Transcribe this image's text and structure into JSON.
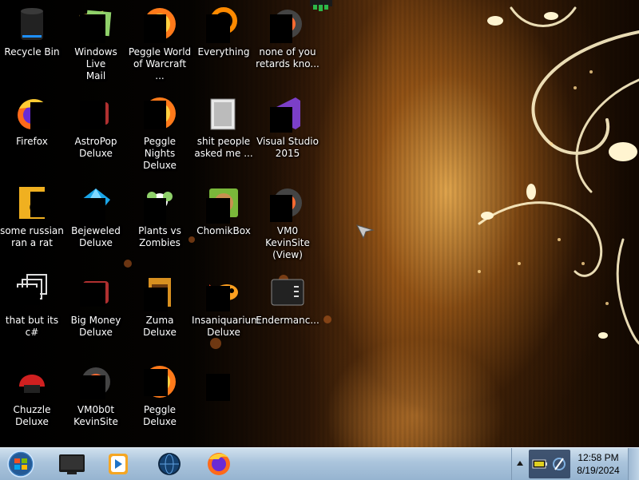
{
  "desktop": {
    "icons": [
      {
        "label": "Recycle Bin",
        "icon": "recycle-bin-icon"
      },
      {
        "label": "Windows Live\nMail",
        "icon": "mail-icon"
      },
      {
        "label": "Peggle World\nof Warcraft ...",
        "icon": "peggle-icon"
      },
      {
        "label": "Everything",
        "icon": "everything-search-icon"
      },
      {
        "label": "none of you\nretards kno...",
        "icon": "app-icon"
      },
      {
        "label": "Firefox",
        "icon": "firefox-icon"
      },
      {
        "label": "AstroPop\nDeluxe",
        "icon": "game-icon"
      },
      {
        "label": "Peggle Nights\nDeluxe",
        "icon": "peggle-icon"
      },
      {
        "label": "shit people\nasked me ...",
        "icon": "folder-icon"
      },
      {
        "label": "Visual Studio\n2015",
        "icon": "visual-studio-icon"
      },
      {
        "label": "some russian\nran a rat",
        "icon": "document-icon"
      },
      {
        "label": "Bejeweled\nDeluxe",
        "icon": "gem-icon"
      },
      {
        "label": "Plants vs\nZombies",
        "icon": "plant-icon"
      },
      {
        "label": "ChomikBox",
        "icon": "hamster-icon"
      },
      {
        "label": "VM0 KevinSite\n(View)",
        "icon": "app-icon"
      },
      {
        "label": "that but its c#",
        "icon": "files-icon"
      },
      {
        "label": "Big Money\nDeluxe",
        "icon": "game-icon"
      },
      {
        "label": "Zuma Deluxe",
        "icon": "zuma-icon"
      },
      {
        "label": "Insaniquarium\nDeluxe",
        "icon": "fish-icon"
      },
      {
        "label": "Endermanc...",
        "icon": "terminal-icon"
      },
      {
        "label": "Chuzzle\nDeluxe",
        "icon": "chuzzle-icon"
      },
      {
        "label": "VM0b0t\nKevinSite",
        "icon": "app-icon"
      },
      {
        "label": "Peggle Deluxe",
        "icon": "peggle-icon"
      }
    ]
  },
  "taskbar": {
    "start": "windows-start-icon",
    "pinned": [
      "monitor-app-icon",
      "media-player-icon",
      "globe-app-icon",
      "firefox-icon"
    ],
    "tray_icons": [
      "show-hidden-icons-chevron",
      "battery-icon",
      "network-icon"
    ],
    "time": "12:58 PM",
    "date": "8/19/2024"
  },
  "colors": {
    "taskbar": "#aac4dc",
    "accent_gold": "#e8a040"
  }
}
